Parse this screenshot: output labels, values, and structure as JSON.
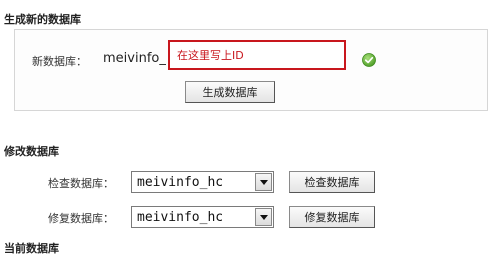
{
  "generate": {
    "title": "生成新的数据库",
    "new_db_label": "新数据库：",
    "prefix": "meivinfo_",
    "input_value": "在这里写上ID",
    "button_label": "生成数据库"
  },
  "modify": {
    "title": "修改数据库",
    "check_label": "检查数据库：",
    "check_select_value": "meivinfo_hc",
    "check_button_label": "检查数据库",
    "repair_label": "修复数据库：",
    "repair_select_value": "meivinfo_hc",
    "repair_button_label": "修复数据库"
  },
  "current": {
    "title": "当前数据库"
  },
  "colors": {
    "highlight_border": "#c8161d",
    "ok_icon": "#5cb032"
  },
  "icons": {
    "ok": "check-circle-icon",
    "dropdown": "chevron-down-icon"
  }
}
